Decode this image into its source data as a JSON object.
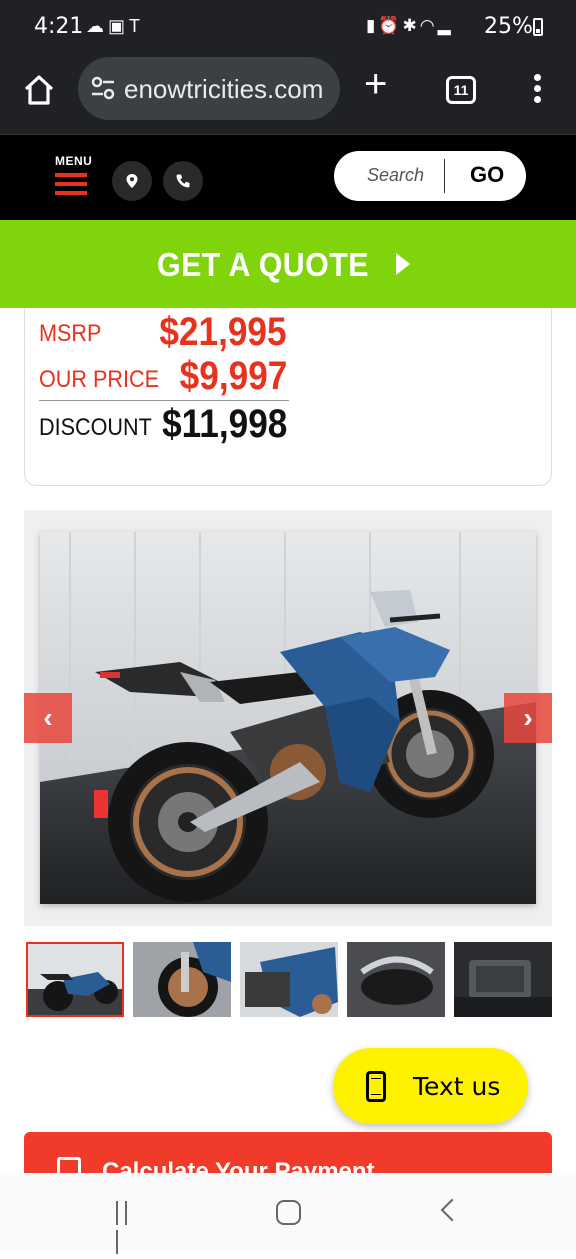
{
  "status_bar": {
    "time": "4:21",
    "battery": "25%",
    "left_icons": [
      "cloud-icon",
      "image-icon",
      "tesla-icon"
    ],
    "right_icons": [
      "battery-saver-icon",
      "alarm-icon",
      "bluetooth-icon",
      "wifi-icon",
      "signal-icon"
    ]
  },
  "browser": {
    "url": "enowtricities.com",
    "tab_count": "11"
  },
  "site_header": {
    "menu_label": "MENU",
    "search_placeholder": "Search",
    "search_button": "GO"
  },
  "quote_banner": {
    "label": "GET A QUOTE"
  },
  "pricing": {
    "msrp_label": "MSRP",
    "msrp_value": "$21,995",
    "our_price_label": "OUR PRICE",
    "our_price_value": "$9,997",
    "discount_label": "DISCOUNT",
    "discount_value": "$11,998"
  },
  "gallery": {
    "thumbnail_count": 5,
    "selected_thumbnail": 1
  },
  "text_us": {
    "label": "Text us"
  },
  "calculator": {
    "label": "Calculate Your Payment"
  },
  "colors": {
    "accent_red": "#e8321e",
    "quote_green": "#80d40b",
    "text_us_yellow": "#fff200"
  }
}
